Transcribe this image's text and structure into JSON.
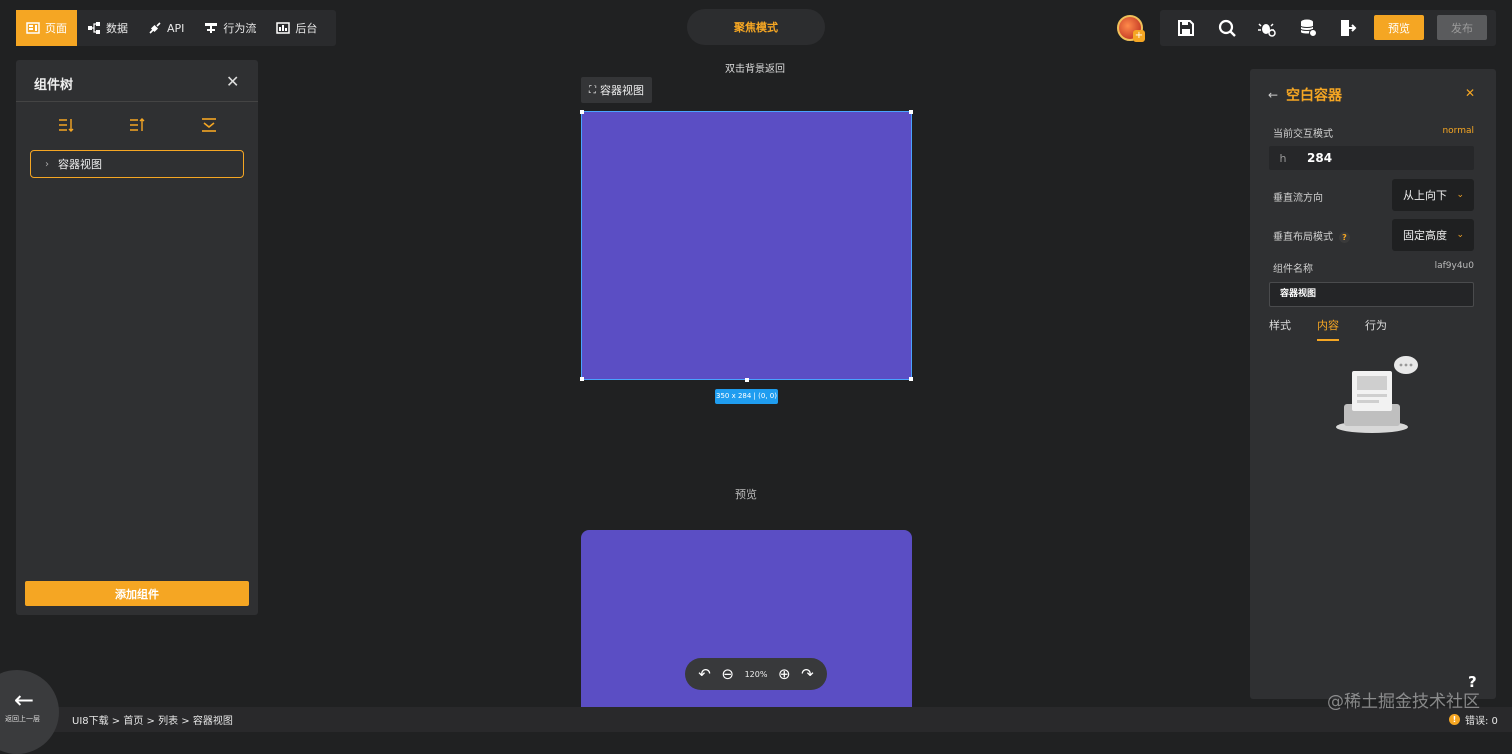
{
  "nav": {
    "items": [
      {
        "label": "页面",
        "icon": "page-icon",
        "active": true
      },
      {
        "label": "数据",
        "icon": "data-icon",
        "active": false
      },
      {
        "label": "API",
        "icon": "api-icon",
        "active": false
      },
      {
        "label": "行为流",
        "icon": "flow-icon",
        "active": false
      },
      {
        "label": "后台",
        "icon": "backend-icon",
        "active": false
      }
    ]
  },
  "focus_mode": "聚焦模式",
  "toolbar": {
    "preview_label": "预览",
    "publish_label": "发布",
    "icons": [
      "save-icon",
      "search-icon",
      "debug-icon",
      "database-icon",
      "export-icon"
    ]
  },
  "left_panel": {
    "title": "组件树",
    "tree_item": "容器视图",
    "add_button": "添加组件"
  },
  "canvas": {
    "hint": "双击背景返回",
    "view_label": "容器视图",
    "size_tag": "350 x 284 | (0, 0)",
    "preview_label": "预览",
    "zoom": "120%"
  },
  "right_panel": {
    "title": "空白容器",
    "interaction_mode_label": "当前交互模式",
    "interaction_mode_value": "normal",
    "h_prefix": "h",
    "h_value": "284",
    "vflow_label": "垂直流方向",
    "vflow_value": "从上向下",
    "vlayout_label": "垂直布局模式",
    "vlayout_value": "固定高度",
    "name_label": "组件名称",
    "component_id": "laf9y4u0",
    "name_value": "容器视图",
    "tabs": [
      "样式",
      "内容",
      "行为"
    ],
    "active_tab": "内容",
    "help": "?"
  },
  "bottom": {
    "back_label": "返回上一层",
    "breadcrumb": "UI8下载 > 首页 > 列表 > 容器视图",
    "errors": "错误: 0",
    "error_icon": "!"
  },
  "watermark": "@稀土掘金技术社区",
  "colors": {
    "accent": "#f5a623",
    "stage": "#5b4ec4",
    "selection": "#4aa3ff",
    "tag": "#1f9df0"
  }
}
